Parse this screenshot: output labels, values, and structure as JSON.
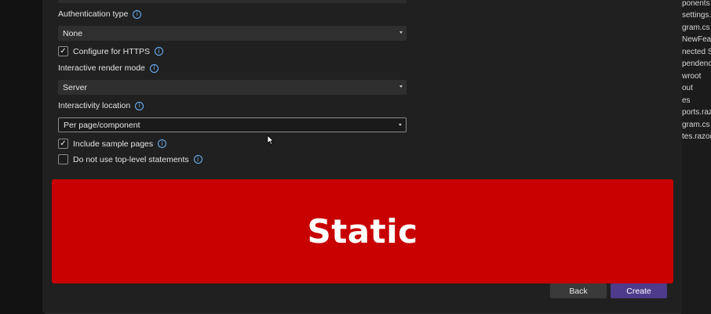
{
  "form": {
    "auth_label": "Authentication type",
    "auth_value": "None",
    "https_label": "Configure for HTTPS",
    "https_checked": true,
    "render_label": "Interactive render mode",
    "render_value": "Server",
    "location_label": "Interactivity location",
    "location_value": "Per page/component",
    "sample_label": "Include sample pages",
    "sample_checked": true,
    "toplevel_label": "Do not use top-level statements",
    "toplevel_checked": false,
    "check_mark": "✓",
    "info_glyph": "i"
  },
  "overlay": {
    "banner_text": "Static",
    "banner_color": "#c80000"
  },
  "buttons": {
    "back": "Back",
    "create": "Create",
    "create_color": "#4e3b8c"
  },
  "sidebar": {
    "items": [
      "ponents",
      "settings.j",
      "gram.cs",
      "NewFeatu",
      "nected S",
      "pendencie",
      "wroot",
      "out",
      "es",
      "ports.razo",
      "gram.cs",
      "tes.razor"
    ]
  }
}
